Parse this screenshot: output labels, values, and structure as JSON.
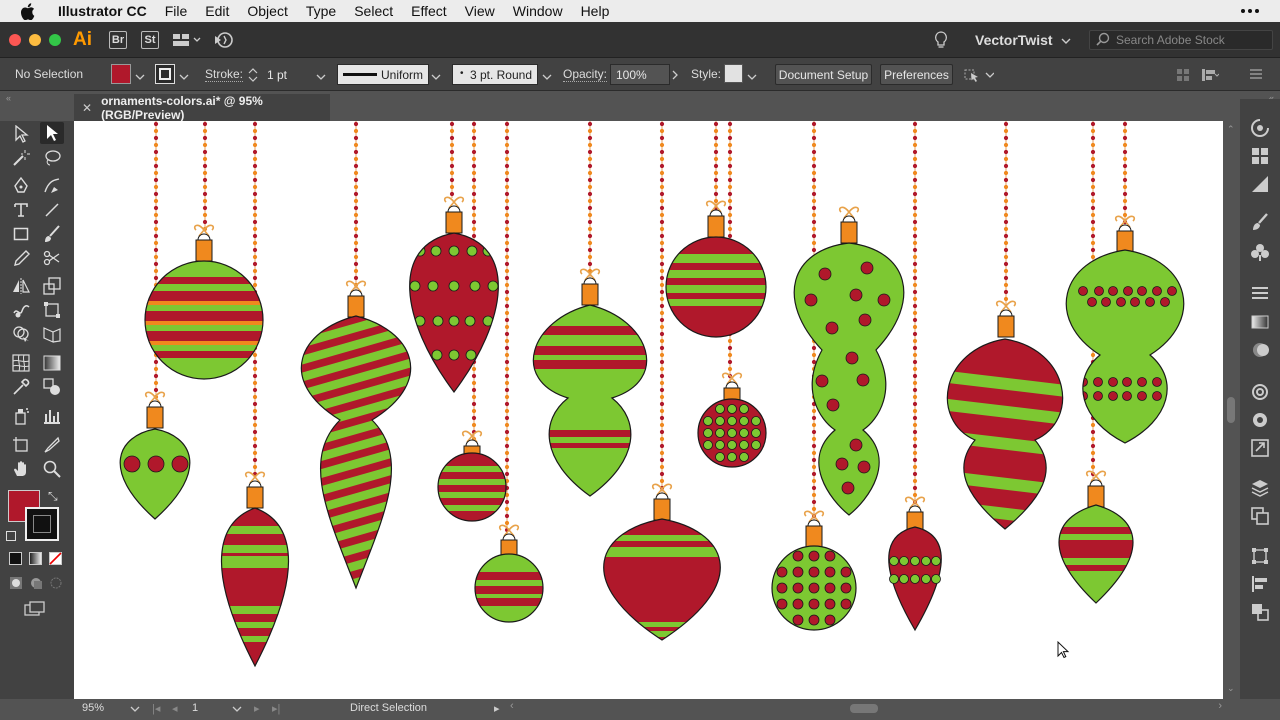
{
  "menubar": {
    "app_name": "Illustrator CC",
    "items": [
      "File",
      "Edit",
      "Object",
      "Type",
      "Select",
      "Effect",
      "View",
      "Window",
      "Help"
    ]
  },
  "appbar": {
    "logo": "Ai",
    "bridge_label": "Br",
    "stock_label": "St",
    "workspace": "VectorTwist",
    "search_placeholder": "Search Adobe Stock"
  },
  "control": {
    "selection_label": "No Selection",
    "fill_color": "#b0182b",
    "stroke_label": "Stroke:",
    "stroke_weight": "1 pt",
    "profile": "Uniform",
    "brush": "3 pt. Round",
    "opacity_label": "Opacity:",
    "opacity_value": "100%",
    "style_label": "Style:",
    "document_setup": "Document Setup",
    "preferences": "Preferences"
  },
  "tab": {
    "title": "ornaments-colors.ai* @ 95% (RGB/Preview)"
  },
  "canvas": {
    "artwork": "holiday-ornaments",
    "colors": {
      "red": "#b0182b",
      "green": "#7dc832",
      "orange": "#f0891e",
      "outline": "#1a1a1a",
      "gold": "#e8a24a"
    }
  },
  "status": {
    "zoom": "95%",
    "artboard": "1",
    "tool": "Direct Selection"
  },
  "colors": {
    "accent": "#ff9a00",
    "panel": "#424242",
    "canvas_bg": "#ffffff"
  }
}
